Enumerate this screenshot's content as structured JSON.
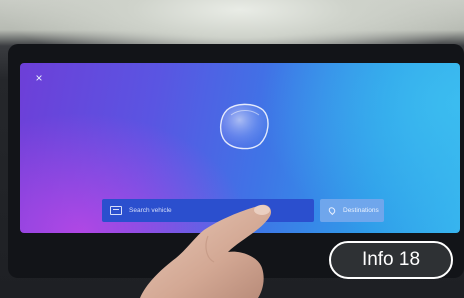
{
  "screen": {
    "close_glyph": "×",
    "search": {
      "icon": "keyboard-icon",
      "placeholder": "Search vehicle"
    },
    "destinations": {
      "icon": "location-pin-icon",
      "label": "Destinations"
    }
  },
  "badge": {
    "label": "Info 18"
  },
  "colors": {
    "screen_gradient": [
      "#6d3fd8",
      "#3f74e6",
      "#36b3ee"
    ],
    "search_bar": "#2b4fce",
    "destinations_button": "#6fa6ec"
  }
}
